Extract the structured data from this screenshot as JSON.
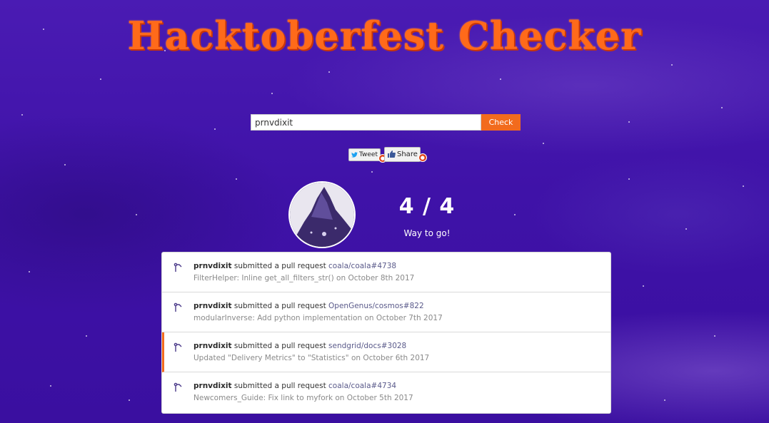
{
  "app": {
    "title": "Hacktoberfest Checker"
  },
  "search": {
    "value": "prnvdixit",
    "button_label": "Check"
  },
  "social": {
    "tweet_label": "Tweet",
    "share_label": "Share"
  },
  "progress": {
    "score_text": "4 / 4",
    "completed": 4,
    "target": 4,
    "message": "Way to go!"
  },
  "pull_requests": [
    {
      "user": "prnvdixit",
      "action": "submitted a pull request",
      "repo": "coala/coala#4738",
      "title": "FilterHelper: Inline get_all_filters_str()",
      "date": "on October 8th 2017"
    },
    {
      "user": "prnvdixit",
      "action": "submitted a pull request",
      "repo": "OpenGenus/cosmos#822",
      "title": "modularInverse: Add python implementation",
      "date": "on October 7th 2017"
    },
    {
      "user": "prnvdixit",
      "action": "submitted a pull request",
      "repo": "sendgrid/docs#3028",
      "title": "Updated \"Delivery Metrics\" to \"Statistics\"",
      "date": "on October 6th 2017"
    },
    {
      "user": "prnvdixit",
      "action": "submitted a pull request",
      "repo": "coala/coala#4734",
      "title": "Newcomers_Guide: Fix link to myfork",
      "date": "on October 5th 2017"
    }
  ],
  "colors": {
    "accent": "#f26b1d",
    "title": "#ff6a1a",
    "background": "#4a1bb3"
  },
  "icons": {
    "pr": "git-pull-request-icon",
    "tweet": "twitter-bird-icon",
    "share": "thumbs-up-icon"
  }
}
